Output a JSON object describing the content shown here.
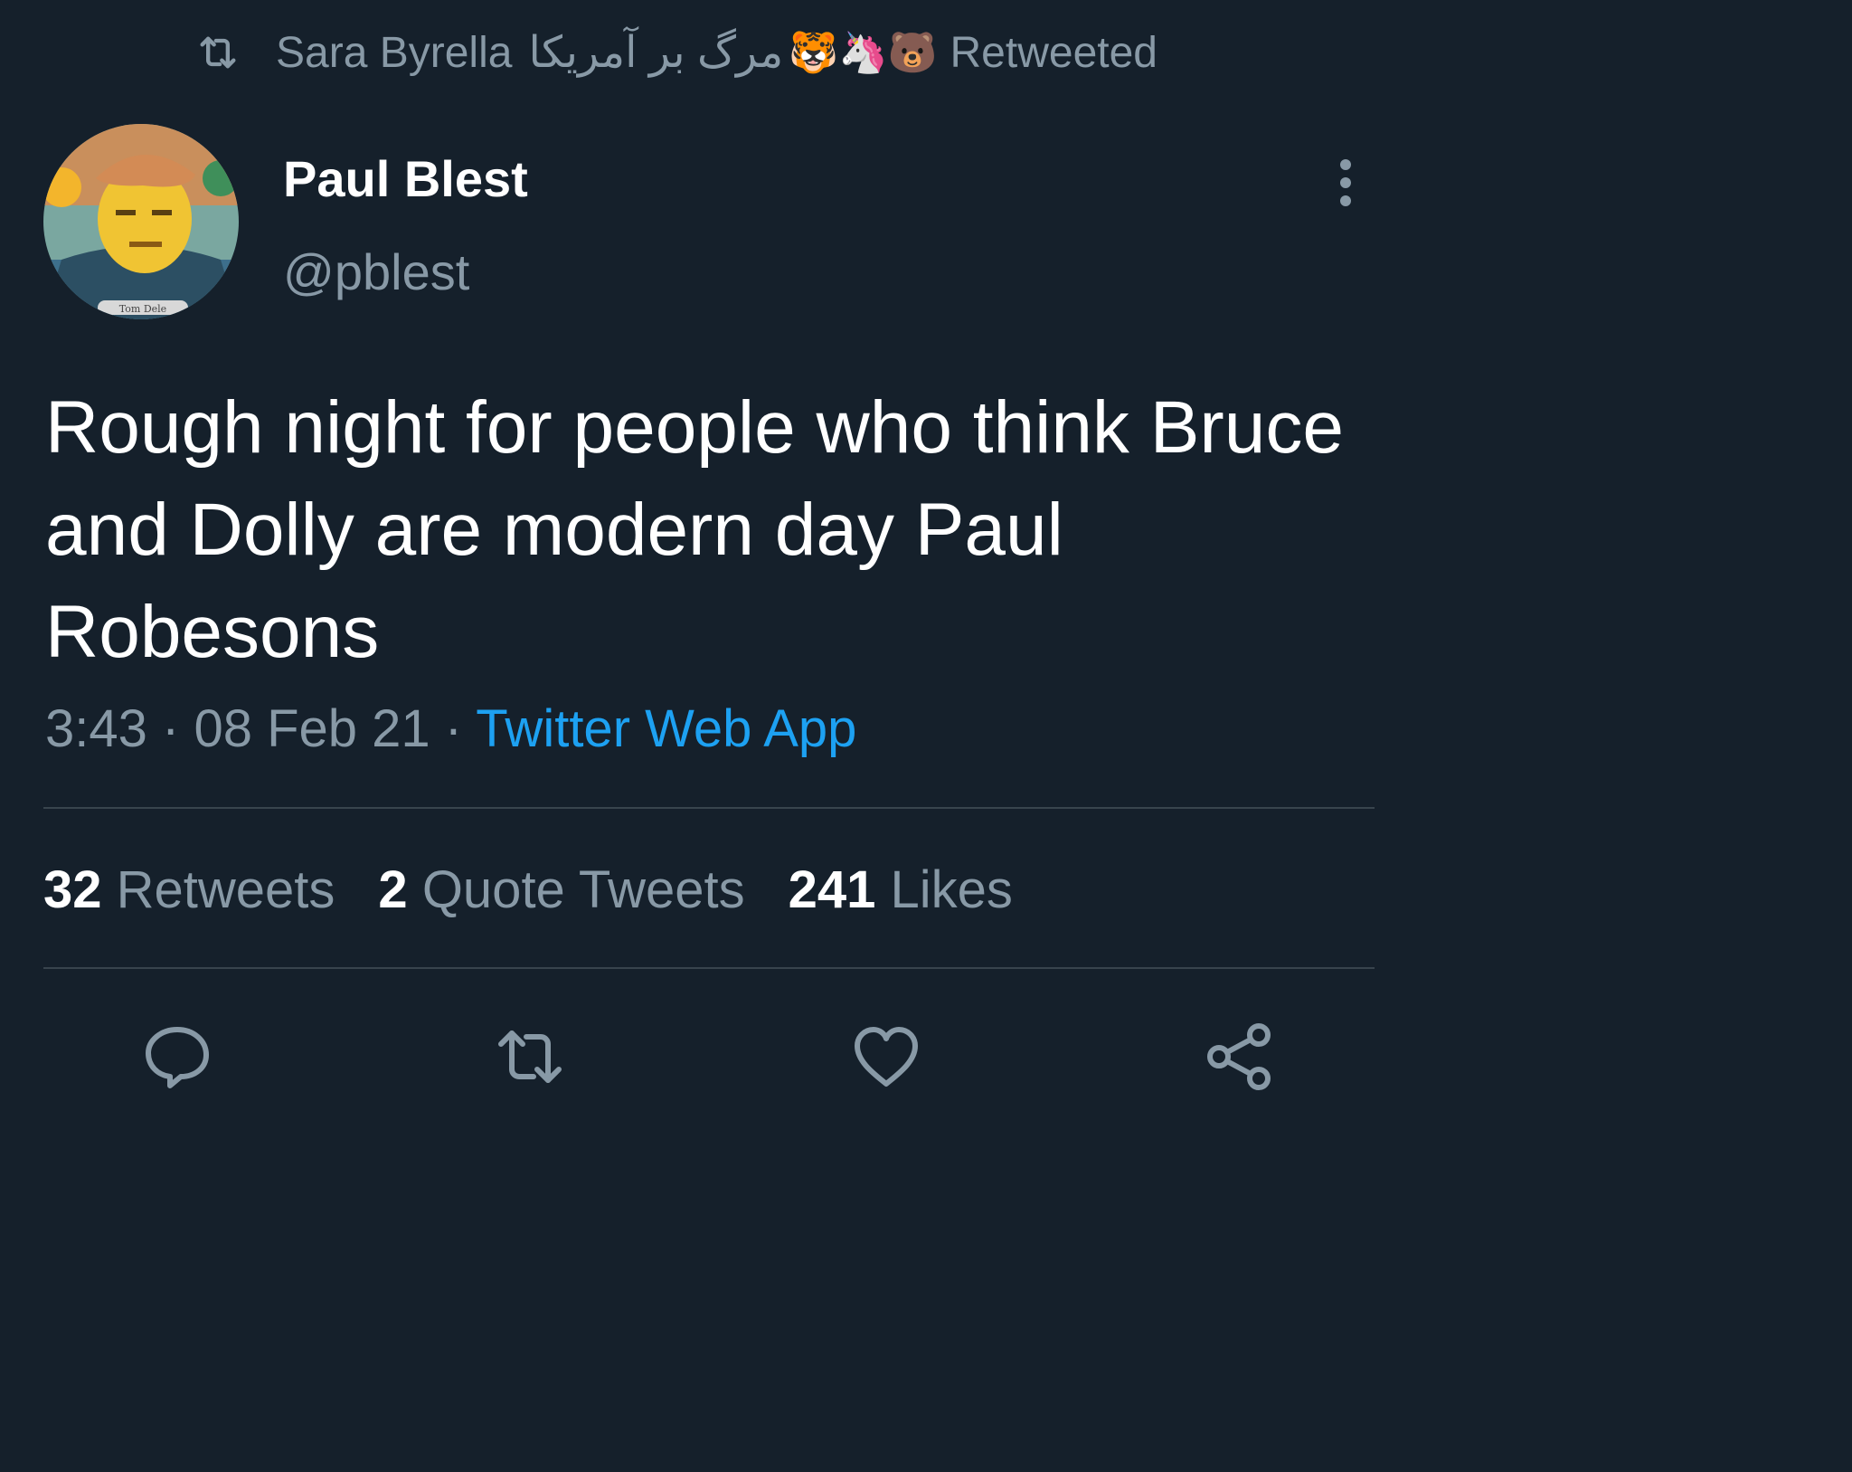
{
  "retweet_header": {
    "retweeter_name": "Sara Byrella",
    "retweeter_name_rtl": "مرگ بر آمریکا",
    "emojis": "🐯🦄🐻",
    "retweeted_label": "Retweeted"
  },
  "author": {
    "display_name": "Paul Blest",
    "handle": "@pblest",
    "avatar_text": "Tom Dele"
  },
  "tweet": {
    "text": "Rough night for people who think Bruce and Dolly are modern day Paul Robesons",
    "time": "3:43",
    "date": "08 Feb 21",
    "separator": "·",
    "source": "Twitter Web App"
  },
  "stats": {
    "retweets_count": "32",
    "retweets_label": "Retweets",
    "quotes_count": "2",
    "quotes_label": "Quote Tweets",
    "likes_count": "241",
    "likes_label": "Likes"
  },
  "colors": {
    "background": "#15202b",
    "secondary_text": "#8899a6",
    "link": "#1da1f2",
    "divider": "#38444d"
  },
  "icons": {
    "retweet_header": "retweet-icon",
    "more": "more-vertical-icon",
    "reply": "reply-icon",
    "retweet": "retweet-icon",
    "like": "heart-icon",
    "share": "share-icon"
  }
}
